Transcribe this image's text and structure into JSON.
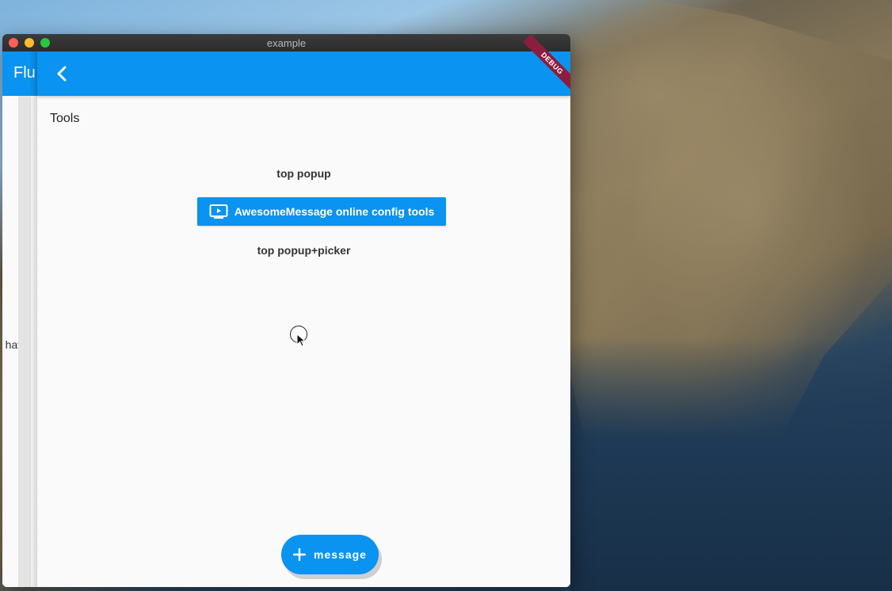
{
  "window": {
    "title": "example"
  },
  "background_route": {
    "title": "Flu",
    "body_text": "u have"
  },
  "appbar": {
    "back_icon": "chevron-left-icon",
    "debug_banner": "DEBUG"
  },
  "content": {
    "section_title": "Tools",
    "top_popup_label": "top popup",
    "config_button": {
      "icon": "tv-play-icon",
      "label": "AwesomeMessage online config tools"
    },
    "top_popup_picker_label": "top popup+picker"
  },
  "fab": {
    "icon": "plus-icon",
    "label": "message"
  },
  "colors": {
    "primary": "#0a93f0",
    "debug": "#8b1d3d",
    "background": "#fafafa"
  }
}
